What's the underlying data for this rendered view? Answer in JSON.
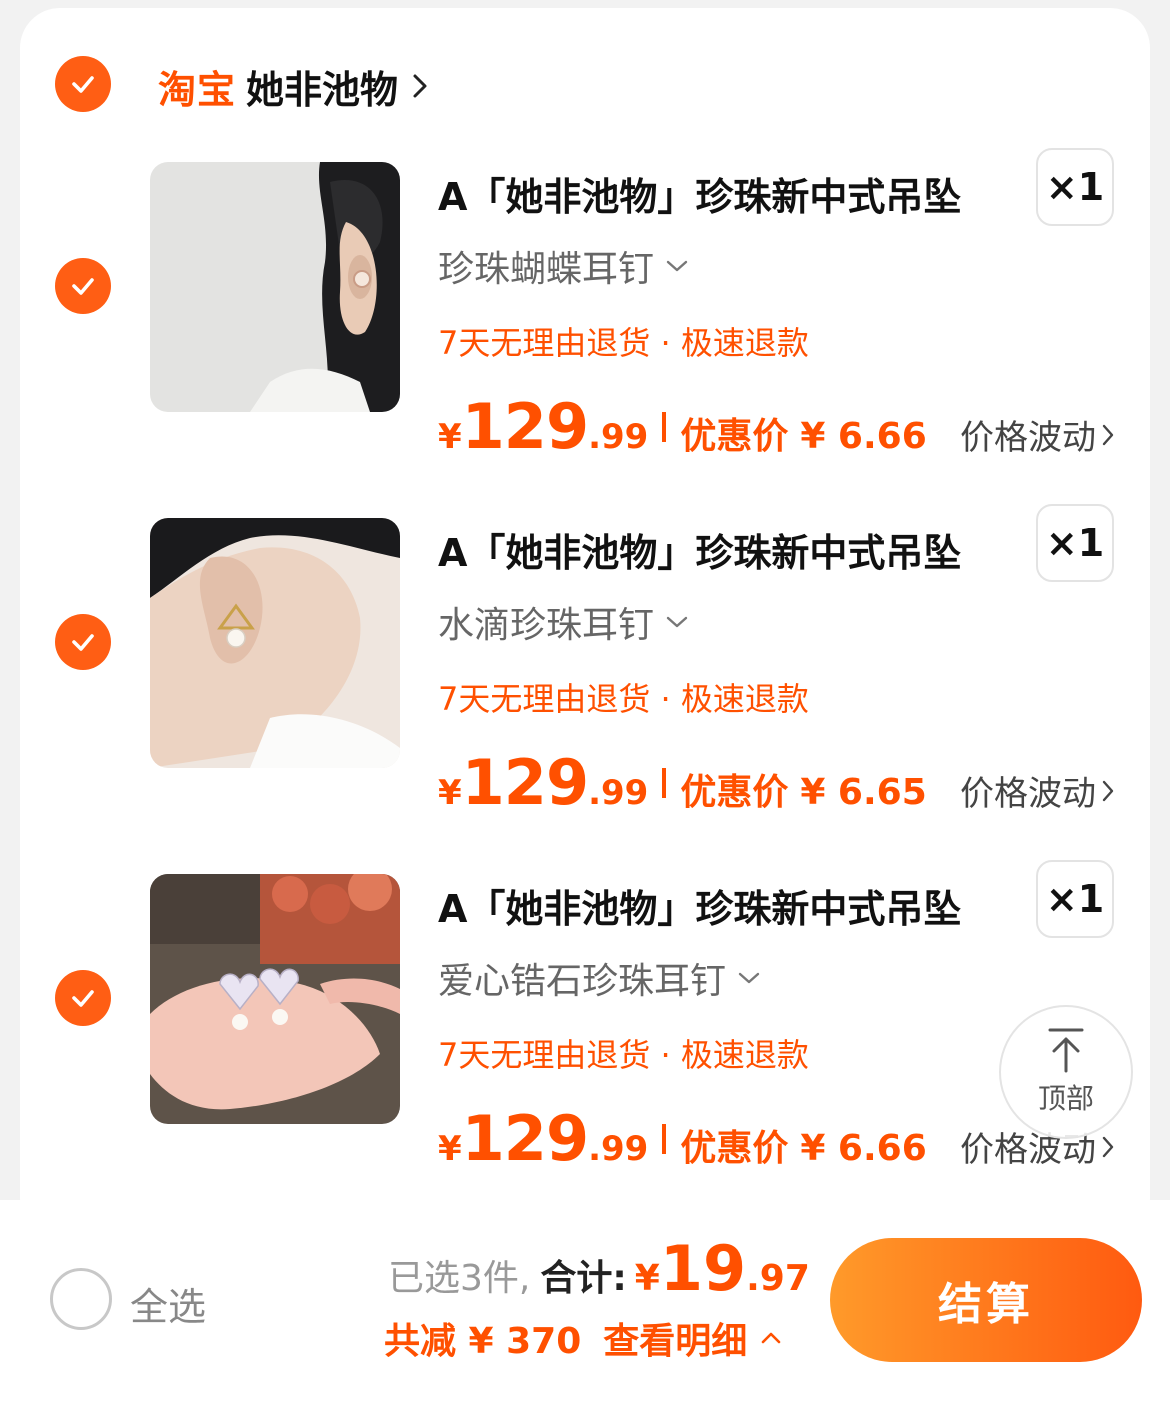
{
  "shop": {
    "brand": "淘宝",
    "name": "她非池物"
  },
  "items": [
    {
      "title": "A「她非池物」珍珠新中式吊坠",
      "qty": "×1",
      "variant": "珍珠蝴蝶耳钉",
      "service": "7天无理由退货 · 极速退款",
      "price_currency": "¥",
      "price_int": "129",
      "price_dec": ".99",
      "discount_label": "优惠价",
      "discount_price": "¥ 6.66",
      "fluctuation": "价格波动"
    },
    {
      "title": "A「她非池物」珍珠新中式吊坠",
      "qty": "×1",
      "variant": "水滴珍珠耳钉",
      "service": "7天无理由退货 · 极速退款",
      "price_currency": "¥",
      "price_int": "129",
      "price_dec": ".99",
      "discount_label": "优惠价",
      "discount_price": "¥ 6.65",
      "fluctuation": "价格波动"
    },
    {
      "title": "A「她非池物」珍珠新中式吊坠",
      "qty": "×1",
      "variant": "爱心锆石珍珠耳钉",
      "service": "7天无理由退货 · 极速退款",
      "price_currency": "¥",
      "price_int": "129",
      "price_dec": ".99",
      "discount_label": "优惠价",
      "discount_price": "¥ 6.66",
      "fluctuation": "价格波动"
    }
  ],
  "top_button": {
    "label": "顶部"
  },
  "footer": {
    "select_all": "全选",
    "selected": "已选3件,",
    "total_label": "合计:",
    "total_currency": "¥",
    "total_int": "19",
    "total_dec": ".97",
    "saving": "共减 ¥ 370",
    "detail": "查看明细",
    "checkout": "结算"
  },
  "colors": {
    "accent": "#ff5000",
    "checkbox": "#ff5e14"
  },
  "icons": [
    "check-icon",
    "chevron-right-icon",
    "chevron-down-icon",
    "chevron-up-icon",
    "arrow-up-icon"
  ]
}
